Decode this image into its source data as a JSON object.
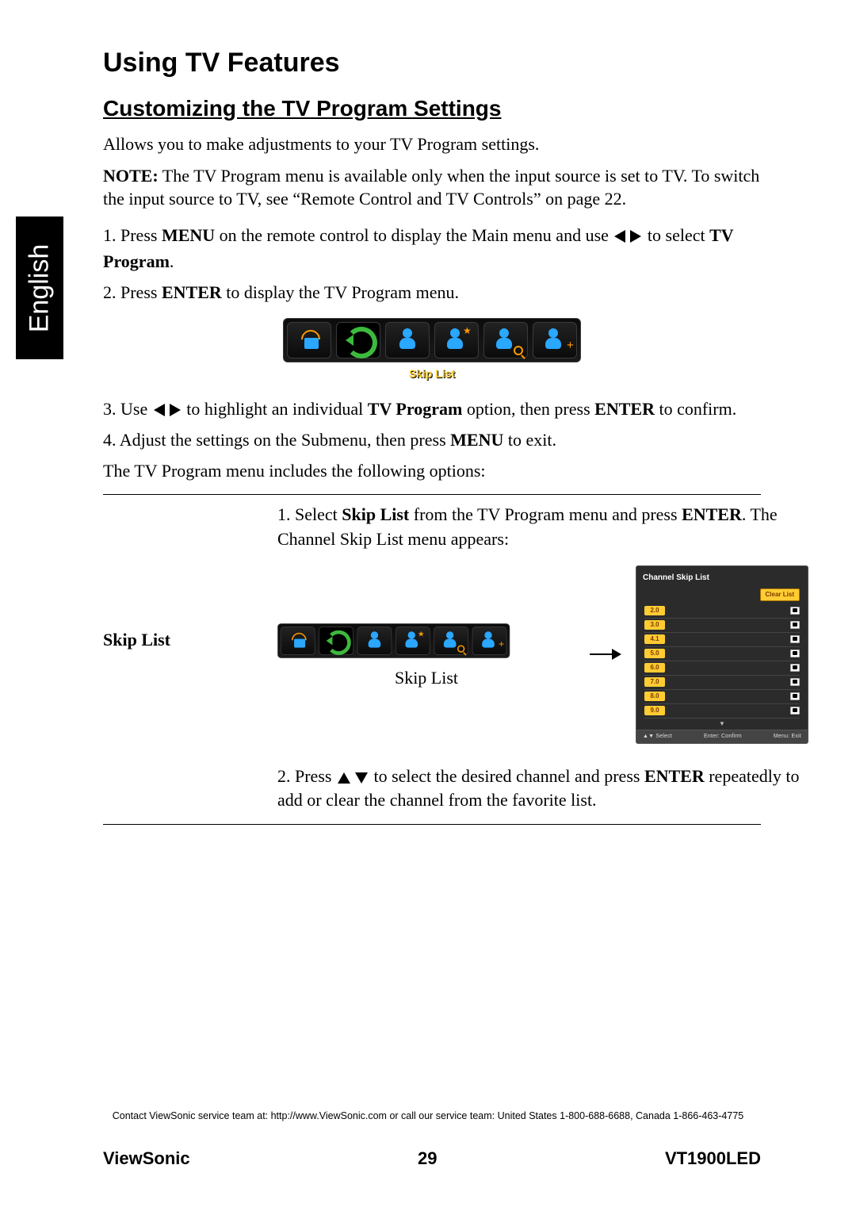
{
  "language_tab": "English",
  "page_title": "Using TV Features",
  "section_title": "Customizing the TV Program Settings",
  "intro": "Allows you to make adjustments to your TV Program settings.",
  "note_label": "NOTE:",
  "note_text": " The TV Program menu is available only when the input source is set to TV. To switch the input source to TV, see “Remote Control and TV Controls” on page 22.",
  "step1_a": "1. Press ",
  "step1_menu": "MENU",
  "step1_b": " on the remote control to display the Main menu and use ",
  "step1_c": " to select ",
  "step1_tvprog": "TV Program",
  "step1_d": ".",
  "step2_a": "2. Press ",
  "step2_enter": "ENTER",
  "step2_b": " to display the TV Program menu.",
  "menu_caption": "Skip List",
  "step3_a": "3. Use ",
  "step3_b": " to highlight an individual ",
  "step3_tvprog": "TV Program",
  "step3_c": " option, then press ",
  "step3_enter": "ENTER",
  "step3_d": " to confirm.",
  "step4_a": "4. Adjust the settings on the Submenu, then press ",
  "step4_menu": "MENU",
  "step4_b": " to exit.",
  "options_intro": "The TV Program menu includes the following options:",
  "skip_label": "Skip List",
  "skip_step1_a": "1.  Select ",
  "skip_step1_skip": "Skip List",
  "skip_step1_b": " from the TV Program menu and press ",
  "skip_step1_enter": "ENTER",
  "skip_step1_c": ". The Channel Skip List menu appears:",
  "menu_caption_small": "Skip List",
  "csl": {
    "title": "Channel Skip List",
    "clear": "Clear List",
    "channels": [
      "2.0",
      "3.0",
      "4.1",
      "5.0",
      "6.0",
      "7.0",
      "8.0",
      "9.0"
    ],
    "footer_select": "▲▼  Select",
    "footer_confirm": "Enter: Confirm",
    "footer_exit": "Menu: Exit"
  },
  "skip_step2_a": "2. Press ",
  "skip_step2_b": " to select the desired channel and press ",
  "skip_step2_enter": "ENTER",
  "skip_step2_c": " repeatedly to add or clear the channel from the favorite list.",
  "contact": "Contact ViewSonic service team at: http://www.ViewSonic.com or call our service team: United States 1-800-688-6688, Canada 1-866-463-4775",
  "footer_brand": "ViewSonic",
  "footer_page": "29",
  "footer_model": "VT1900LED"
}
